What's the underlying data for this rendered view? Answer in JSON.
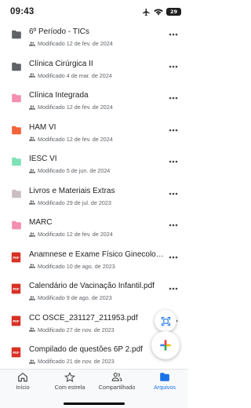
{
  "status": {
    "time": "09:43",
    "battery": "29"
  },
  "files": [
    {
      "type": "folder",
      "color": "#5f6368",
      "name": "6º Período - TICs",
      "meta": "Modificado 12 de fev. de 2024"
    },
    {
      "type": "folder",
      "color": "#5f6368",
      "name": "Clínica Cirúrgica II",
      "meta": "Modificado 4 de mar. de 2024"
    },
    {
      "type": "folder",
      "color": "#f48fb1",
      "name": "Clínica Integrada",
      "meta": "Modificado 12 de fev. de 2024"
    },
    {
      "type": "folder",
      "color": "#f4623a",
      "name": "HAM VI",
      "meta": "Modificado 12 de fev. de 2024"
    },
    {
      "type": "folder",
      "color": "#7ee2b8",
      "name": "IESC VI",
      "meta": "Modificado 5 de jun. de 2024"
    },
    {
      "type": "folder",
      "color": "#c9bfc3",
      "name": "Livros e Materiais Extras",
      "meta": "Modificado 29 de jul. de 2023"
    },
    {
      "type": "folder",
      "color": "#f48fb1",
      "name": "MARC",
      "meta": "Modificado 12 de fev. de 2024"
    },
    {
      "type": "pdf",
      "color": "#d93025",
      "name": "Anamnese e Exame Físico Ginecologia...",
      "meta": "Modificado 10 de ago. de 2023"
    },
    {
      "type": "pdf",
      "color": "#d93025",
      "name": "Calendário de Vacinação Infantil.pdf",
      "meta": "Modificado 9 de ago. de 2023"
    },
    {
      "type": "pdf",
      "color": "#d93025",
      "name": "CC OSCE_231127_211953.pdf",
      "meta": "Modificado 27 de nov. de 2023"
    },
    {
      "type": "pdf",
      "color": "#d93025",
      "name": "Compilado de questões 6P 2.pdf",
      "meta": "Modificado 21 de nov. de 2023"
    }
  ],
  "nav": [
    {
      "label": "Início",
      "icon": "home-icon"
    },
    {
      "label": "Com estrela",
      "icon": "star-icon"
    },
    {
      "label": "Compartilhado",
      "icon": "shared-people-icon"
    },
    {
      "label": "Arquivos",
      "icon": "folder-icon",
      "active": true
    }
  ],
  "colors": {
    "accent": "#1a73e8",
    "text": "#1f1f1f",
    "meta": "#5f6368"
  }
}
